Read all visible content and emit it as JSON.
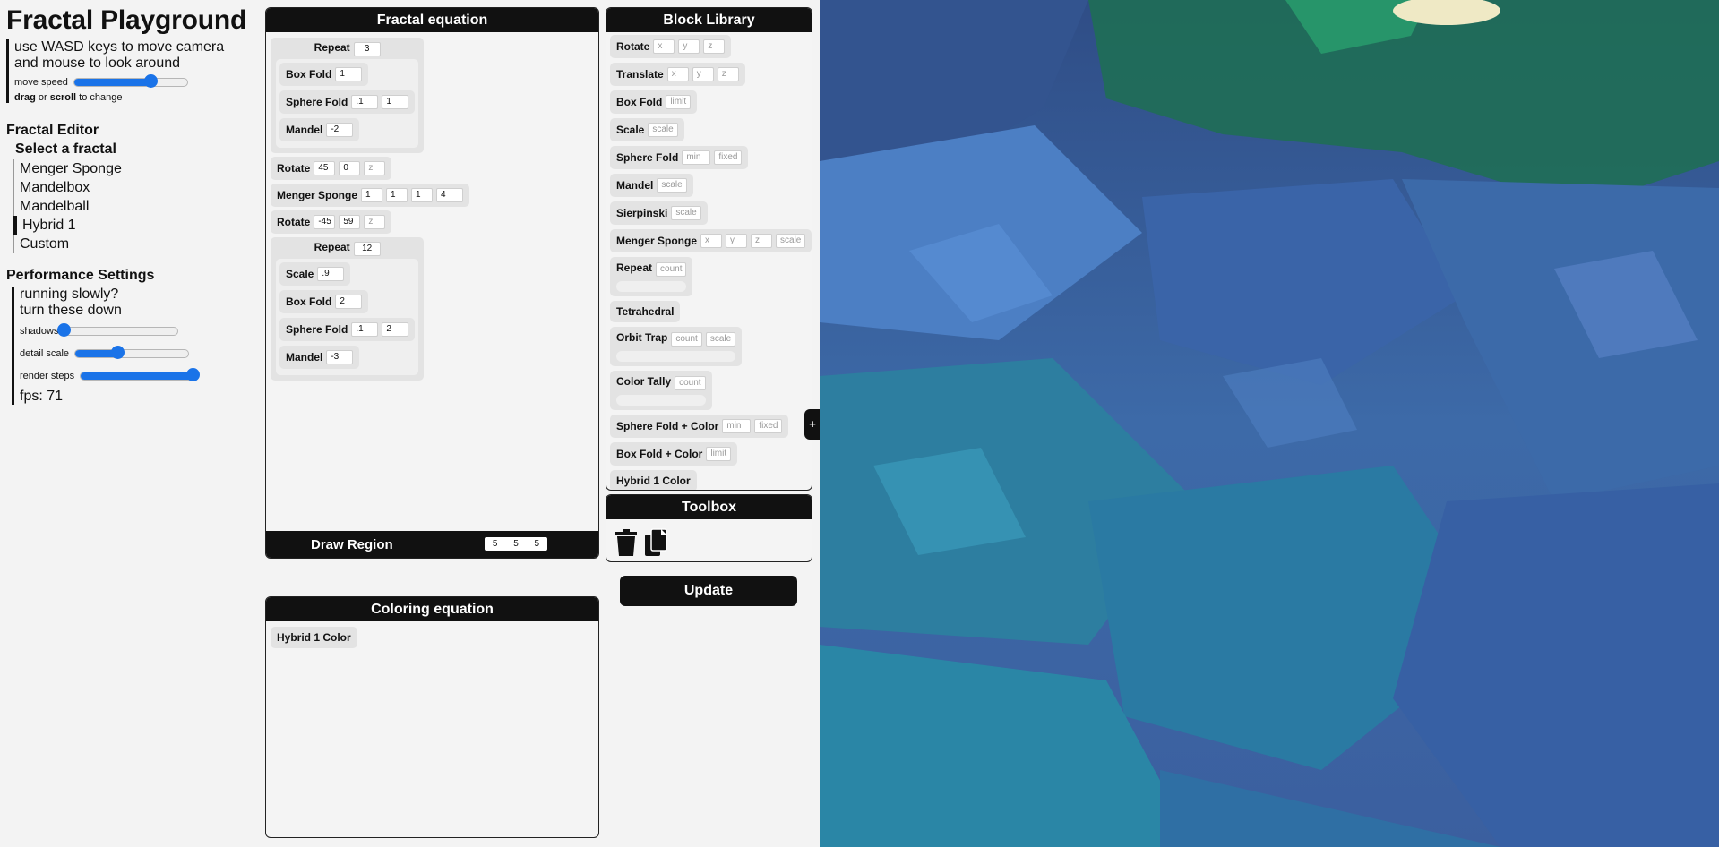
{
  "app": {
    "title": "Fractal Playground"
  },
  "help": {
    "line1": "use WASD keys to move camera",
    "line2": "and mouse to look around",
    "move_speed_label": "move speed",
    "move_speed_value": 0.68,
    "drag_word": "drag",
    "or_word": " or ",
    "scroll_word": "scroll",
    "to_change": " to change"
  },
  "fractal_editor": {
    "heading": "Fractal Editor",
    "select_label": "Select a fractal",
    "items": [
      "Menger Sponge",
      "Mandelbox",
      "Mandelball",
      "Hybrid 1",
      "Custom"
    ],
    "selected": "Hybrid 1"
  },
  "performance": {
    "heading": "Performance Settings",
    "line1": "running slowly?",
    "line2": "turn these down",
    "shadows_label": "shadows",
    "shadows_value": 0.0,
    "detail_label": "detail scale",
    "detail_value": 0.38,
    "steps_label": "render steps",
    "steps_value": 1.0,
    "fps_text": "fps: 71"
  },
  "fractal_equation": {
    "title": "Fractal equation",
    "repeat1": {
      "label": "Repeat",
      "count": "3"
    },
    "boxfold1": {
      "label": "Box Fold",
      "v": "1"
    },
    "spherefold1": {
      "label": "Sphere Fold",
      "min": ".1",
      "fixed": "1"
    },
    "mandel1": {
      "label": "Mandel",
      "v": "-2"
    },
    "rotate1": {
      "label": "Rotate",
      "x": "45",
      "y": "0",
      "z": "z"
    },
    "menger": {
      "label": "Menger Sponge",
      "x": "1",
      "y": "1",
      "z": "1",
      "scale": "4"
    },
    "rotate2": {
      "label": "Rotate",
      "x": "-45",
      "y": "59",
      "z": "z"
    },
    "repeat2": {
      "label": "Repeat",
      "count": "12"
    },
    "scale2": {
      "label": "Scale",
      "v": ".9"
    },
    "boxfold2": {
      "label": "Box Fold",
      "v": "2"
    },
    "spherefold2": {
      "label": "Sphere Fold",
      "min": ".1",
      "fixed": "2"
    },
    "mandel2": {
      "label": "Mandel",
      "v": "-3"
    },
    "draw_region_label": "Draw Region",
    "draw_region": [
      "5",
      "5",
      "5"
    ]
  },
  "coloring_equation": {
    "title": "Coloring equation",
    "block": "Hybrid 1 Color"
  },
  "library": {
    "title": "Block Library",
    "rotate": "Rotate",
    "translate": "Translate",
    "boxfold": "Box Fold",
    "scale": "Scale",
    "spherefold": "Sphere Fold",
    "mandel": "Mandel",
    "sierpinski": "Sierpinski",
    "menger": "Menger Sponge",
    "repeat": "Repeat",
    "tetrahedral": "Tetrahedral",
    "orbit": "Orbit Trap",
    "colortally": "Color Tally",
    "sfcolor": "Sphere Fold + Color",
    "bfcolor": "Box Fold + Color",
    "hybridcolor": "Hybrid 1 Color",
    "ph_x": "x",
    "ph_y": "y",
    "ph_z": "z",
    "ph_limit": "limit",
    "ph_scale": "scale",
    "ph_min": "min",
    "ph_fixed": "fixed",
    "ph_count": "count"
  },
  "toolbox": {
    "title": "Toolbox",
    "icons": [
      "trash-icon",
      "copy-icon"
    ]
  },
  "update_button": "Update",
  "collapse_tab": "+",
  "colors": {
    "accent": "#1a73e8",
    "panel_header": "#111111",
    "block_bg": "#e3e3e3"
  }
}
